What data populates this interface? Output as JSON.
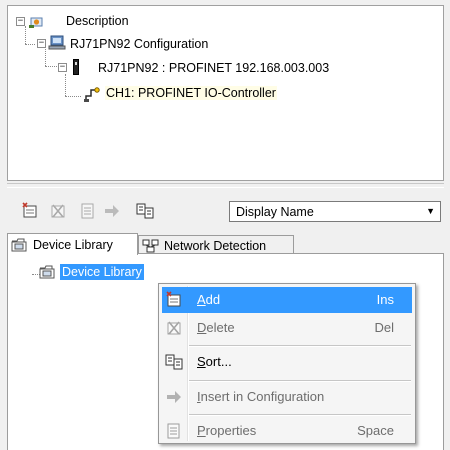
{
  "config_tree": {
    "root": {
      "label": "Description",
      "icon": "description-icon"
    },
    "configuration": {
      "label": "RJ71PN92 Configuration",
      "icon": "computer-icon"
    },
    "module": {
      "label": "RJ71PN92 : PROFINET 192.168.003.003",
      "icon": "module-icon"
    },
    "channel": {
      "label": "CH1: PROFINET IO-Controller",
      "icon": "io-controller-icon"
    }
  },
  "toolbar": {
    "buttons": [
      {
        "name": "add-icon",
        "enabled": true
      },
      {
        "name": "delete-icon",
        "enabled": false
      },
      {
        "name": "properties-icon",
        "enabled": false
      },
      {
        "name": "insert-arrow-icon",
        "enabled": false
      },
      {
        "name": "sort-icon",
        "enabled": true
      }
    ],
    "display_select": {
      "value": "Display Name"
    }
  },
  "tabs": [
    {
      "label": "Device Library",
      "icon": "library-folder-icon",
      "active": true
    },
    {
      "label": "Network Detection",
      "icon": "network-detection-icon",
      "active": false
    }
  ],
  "library_tree": {
    "root": {
      "label": "Device Library",
      "selected": true
    }
  },
  "context_menu": {
    "items": [
      {
        "mnemonic": "A",
        "rest": "dd",
        "shortcut": "Ins",
        "enabled": true,
        "hover": true,
        "icon": "add-icon"
      },
      {
        "mnemonic": "D",
        "rest": "elete",
        "shortcut": "Del",
        "enabled": false,
        "icon": "delete-icon"
      },
      {
        "mnemonic": "S",
        "rest": "ort...",
        "shortcut": "",
        "enabled": true,
        "icon": "sort-icon"
      },
      {
        "mnemonic": "I",
        "rest": "nsert in Configuration",
        "shortcut": "",
        "enabled": false,
        "icon": "insert-arrow-icon"
      },
      {
        "mnemonic": "P",
        "rest": "roperties",
        "shortcut": "Space",
        "enabled": false,
        "icon": "properties-icon"
      }
    ]
  },
  "colors": {
    "selection": "#3399ff",
    "channel_highlight": "#fffde6"
  }
}
